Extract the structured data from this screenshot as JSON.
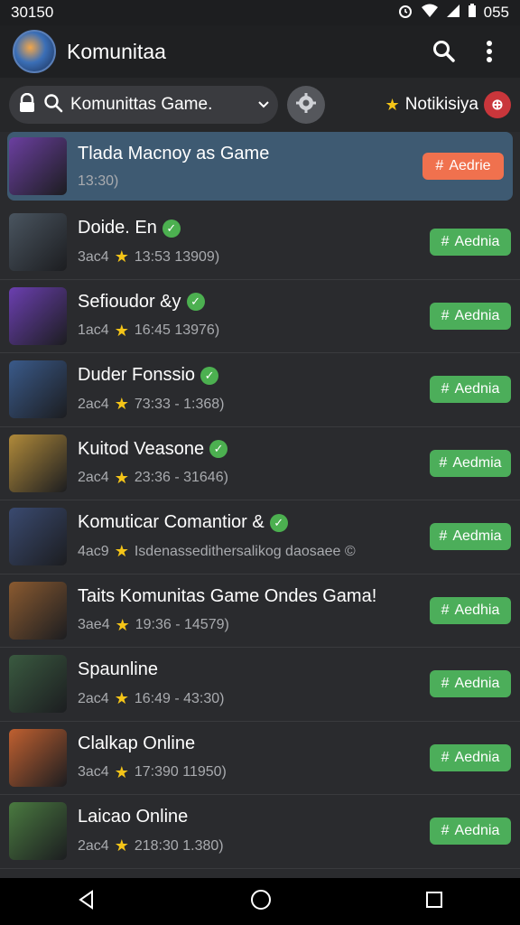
{
  "status_bar": {
    "time": "30150",
    "battery": "055"
  },
  "app_bar": {
    "title": "Komunitaa",
    "search_icon": "search-icon",
    "menu_icon": "more-vert-icon"
  },
  "filter_bar": {
    "search_text": "Komunittas Game.",
    "lock_icon": "lock-icon",
    "gear_icon": "gear-icon",
    "notif_label": "Notikisiya"
  },
  "action_label": "Aedrie",
  "action_label_alt": "Aedhia",
  "items": [
    {
      "title": "Tlada Macnoy as Game",
      "meta": "13:30)",
      "thumb": "#6b3fa0",
      "accent": "#f0714e",
      "button": "Aedrie"
    },
    {
      "title": "Doide. En",
      "meta_a": "3ac4",
      "meta_b": "13:53  13909)",
      "thumb": "#4a5560",
      "button": "Aednia"
    },
    {
      "title": "Sefioudor &y",
      "meta_a": "1ac4",
      "meta_b": "16:45  13976)",
      "thumb": "#6b3fb0",
      "button": "Aednia"
    },
    {
      "title": "Duder Fonssio",
      "meta_a": "2ac4",
      "meta_b": "73:33 - 1:368)",
      "thumb": "#3a5a8a",
      "button": "Aednia"
    },
    {
      "title": "Kuitod Veasone",
      "meta_a": "2ac4",
      "meta_b": "23:36 - 31646)",
      "thumb": "#b08a3a",
      "button": "Aedmia"
    },
    {
      "title": "Komuticar Comantior &",
      "meta_a": "4ac9",
      "meta_b": "Isdenassedithersalikog daosaee  ©",
      "thumb": "#3a4a70",
      "button": "Aedmia"
    },
    {
      "title": "Taits Komunitas Game Ondes Gama!",
      "meta_a": "3ae4",
      "meta_b": "19:36 - 14579)",
      "thumb": "#8a5a30",
      "button": "Aedhia"
    },
    {
      "title": "Spaunline",
      "meta_a": "2ac4",
      "meta_b": "16:49 - 43:30)",
      "thumb": "#3a5a40",
      "button": "Aednia"
    },
    {
      "title": "Clalkap Online",
      "meta_a": "3ac4",
      "meta_b": "17:390  11950)",
      "thumb": "#c06030",
      "button": "Aednia"
    },
    {
      "title": "Laicao Online",
      "meta_a": "2ac4",
      "meta_b": "218:30  1.380)",
      "thumb": "#4a7a40",
      "button": "Aednia"
    }
  ],
  "colors": {
    "accent_green": "#4cae5a",
    "accent_orange": "#f0714e",
    "active_row": "#3e5a72",
    "verified": "#4cb050"
  }
}
